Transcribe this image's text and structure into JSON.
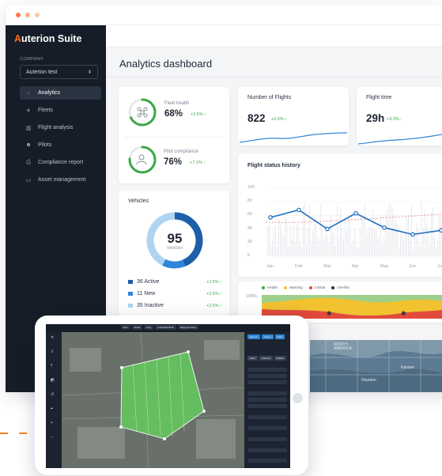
{
  "app": {
    "brand_accent": "A",
    "brand_rest": "uterion Suite",
    "accent_color": "#ff6a13",
    "sidebar_bg": "#161d28"
  },
  "sidebar": {
    "company_label": "COMPANY",
    "company_value": "Auterion test",
    "items": [
      {
        "label": "Analytics",
        "icon": "analytics-icon",
        "active": true
      },
      {
        "label": "Fleets",
        "icon": "fleet-icon"
      },
      {
        "label": "Flight analysis",
        "icon": "flight-analysis-icon"
      },
      {
        "label": "Pilots",
        "icon": "pilot-icon"
      },
      {
        "label": "Compliance report",
        "icon": "compliance-icon"
      },
      {
        "label": "Asset management",
        "icon": "asset-icon"
      }
    ]
  },
  "page": {
    "title": "Analytics dashboard"
  },
  "kpis": {
    "fleet_health": {
      "label": "Fleet health",
      "value": "68%",
      "delta": "+2.5% ↑",
      "fraction": 0.68
    },
    "pilot_compliance": {
      "label": "Pilot compliance",
      "value": "76%",
      "delta": "+7.1% ↑",
      "fraction": 0.76
    }
  },
  "flights": {
    "label": "Number of Flights",
    "value": "822",
    "delta": "+2.5% ↑"
  },
  "flight_time": {
    "label": "Flight time",
    "value": "29h",
    "delta": "+3.3% ↑"
  },
  "vehicles": {
    "title": "Vehicles",
    "total": "95",
    "total_label": "Vehicles",
    "legend": [
      {
        "label": "36 Active",
        "delta": "+2.5% ↑",
        "color": "#1d5fa8",
        "count": 36
      },
      {
        "label": "11 New",
        "delta": "+2.5% ↑",
        "color": "#2f86d8",
        "count": 11
      },
      {
        "label": "35 Inactive",
        "delta": "+2.5% ↑",
        "color": "#aed4f2",
        "count": 35
      }
    ]
  },
  "status_history": {
    "title": "Flight status history",
    "ticks": [
      "100",
      "80",
      "60",
      "40",
      "20",
      "0"
    ],
    "months": [
      "Jan",
      "Feb",
      "Mar",
      "Apr",
      "May",
      "Jun",
      "Jul"
    ]
  },
  "status_band": {
    "axis_label": "100%",
    "legend": [
      {
        "label": "Health",
        "color": "#3aa845"
      },
      {
        "label": "Warning",
        "color": "#f2c230"
      },
      {
        "label": "Critical",
        "color": "#e24a3b"
      },
      {
        "label": "Overfits",
        "color": "#223048"
      }
    ]
  },
  "tablet": {
    "toolbar_buttons": [
      "Run",
      "Circle",
      "Poly",
      "Load KML/SHP",
      "Waypoint Scan"
    ],
    "panel_tabs": [
      "Mission",
      "Fence",
      "Rally"
    ],
    "panel_subtabs": [
      "Scan",
      "Camera",
      "Pattern"
    ]
  },
  "chart_data": [
    {
      "type": "line",
      "title": "Flight status history",
      "categories": [
        "Jan",
        "Feb",
        "Mar",
        "Apr",
        "May",
        "Jun",
        "Jul"
      ],
      "series": [
        {
          "values": [
            57,
            68,
            40,
            63,
            42,
            32,
            38
          ]
        }
      ],
      "ylim": [
        0,
        100
      ],
      "grid": true
    },
    {
      "type": "pie",
      "title": "Vehicles",
      "categories": [
        "Active",
        "New",
        "Inactive"
      ],
      "values": [
        36,
        11,
        35
      ]
    }
  ]
}
